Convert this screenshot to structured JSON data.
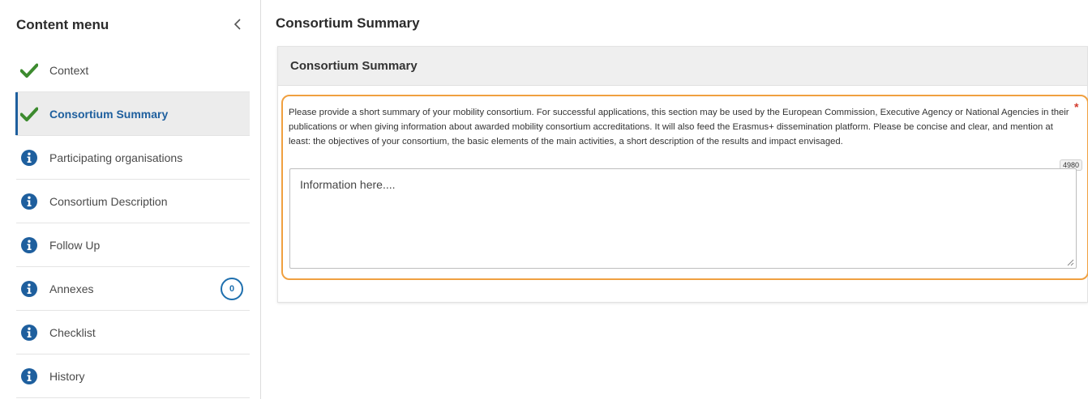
{
  "sidebar": {
    "title": "Content menu",
    "collapse_icon": "chevron-left-icon",
    "items": [
      {
        "label": "Context",
        "icon": "check-icon",
        "active": false
      },
      {
        "label": "Consortium Summary",
        "icon": "check-icon",
        "active": true
      },
      {
        "label": "Participating organisations",
        "icon": "info-icon",
        "active": false
      },
      {
        "label": "Consortium Description",
        "icon": "info-icon",
        "active": false
      },
      {
        "label": "Follow Up",
        "icon": "info-icon",
        "active": false
      },
      {
        "label": "Annexes",
        "icon": "info-icon",
        "active": false,
        "badge": "0"
      },
      {
        "label": "Checklist",
        "icon": "info-icon",
        "active": false
      },
      {
        "label": "History",
        "icon": "info-icon",
        "active": false
      }
    ]
  },
  "main": {
    "page_title": "Consortium Summary",
    "panel_title": "Consortium Summary",
    "field": {
      "description": "Please provide a short summary of your mobility consortium. For successful applications, this section may be used by the European Commission, Executive Agency or National Agencies in their publications or when giving information about awarded mobility consortium accreditations. It will also feed the Erasmus+ dissemination platform. Please be concise and clear, and mention at least: the objectives of your consortium, the basic elements of the main activities, a short description of the results and impact envisaged.",
      "required_mark": "*",
      "char_counter": "4980",
      "value": "Information here...."
    }
  },
  "colors": {
    "check": "#3d8b2f",
    "info": "#1e5f9e",
    "active_accent": "#1e5f9e",
    "highlight": "#f0a040",
    "required": "#d33a2c"
  }
}
